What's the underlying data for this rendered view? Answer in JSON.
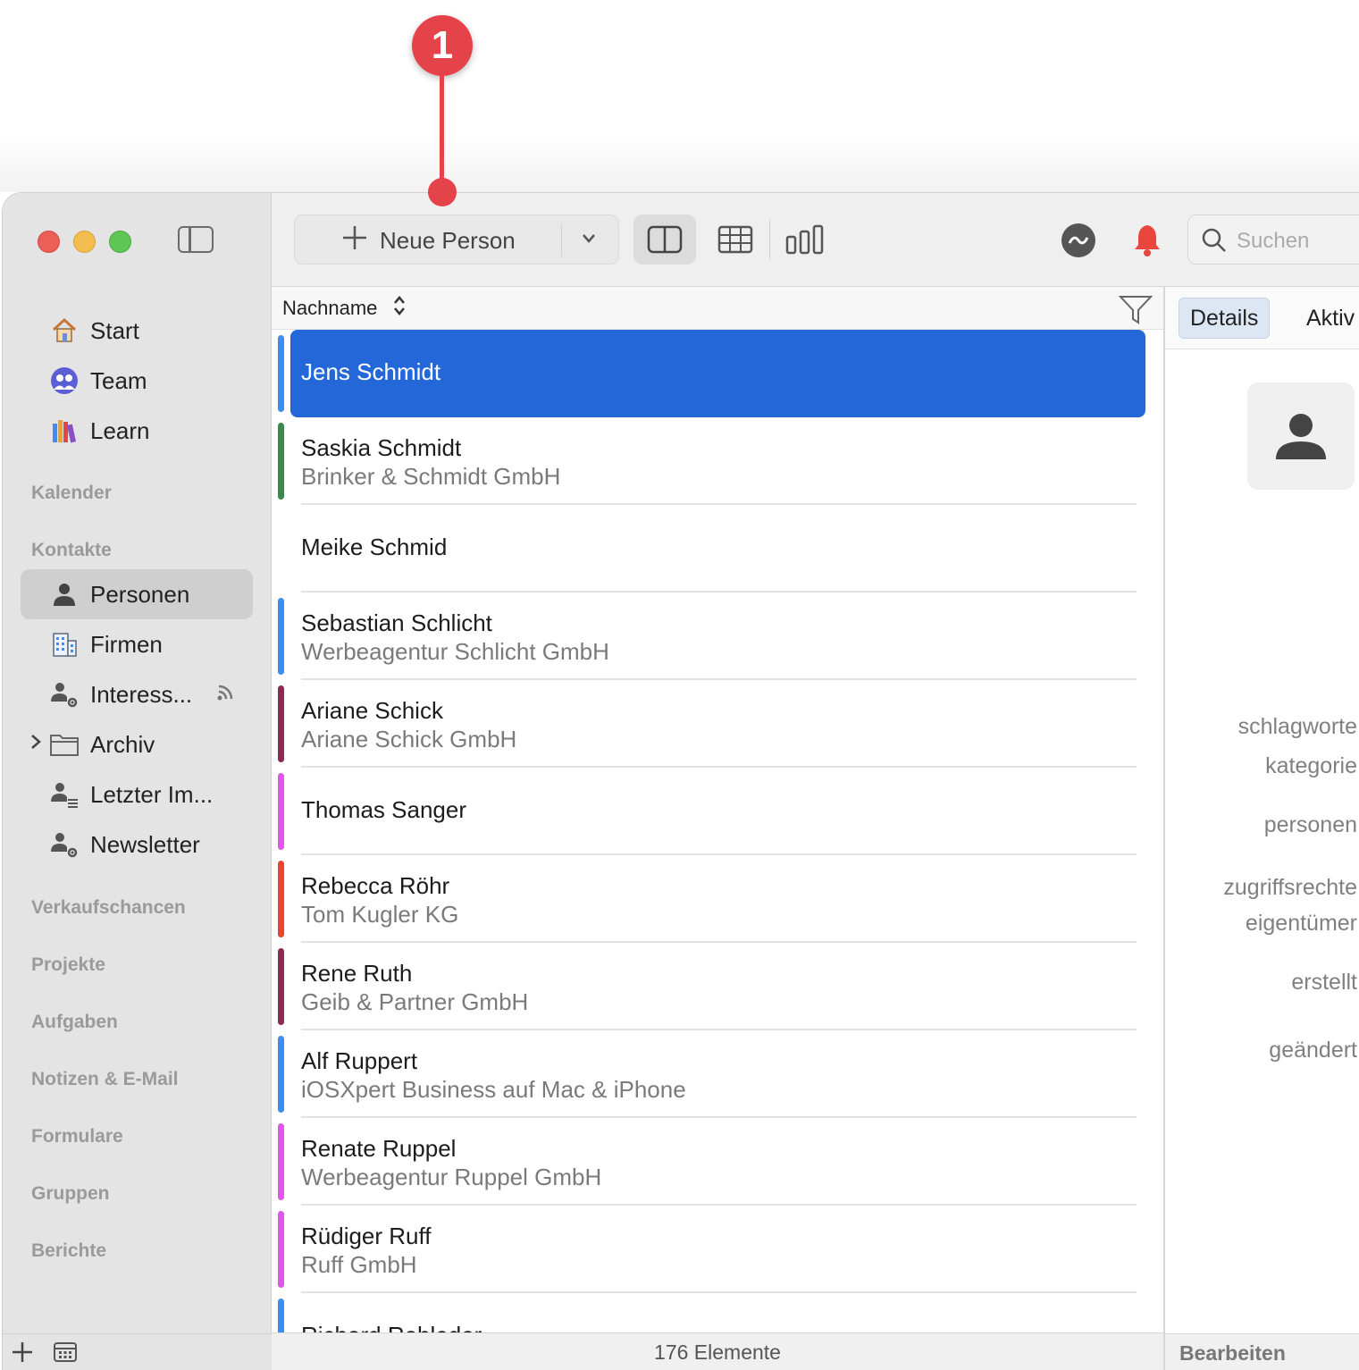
{
  "callout": {
    "number": "1"
  },
  "sidebar": {
    "items": [
      {
        "label": "Start",
        "icon": "house-icon"
      },
      {
        "label": "Team",
        "icon": "team-icon"
      },
      {
        "label": "Learn",
        "icon": "books-icon"
      }
    ],
    "sections": {
      "kalender": "Kalender",
      "kontakte": "Kontakte",
      "verkaufschancen": "Verkaufschancen",
      "projekte": "Projekte",
      "aufgaben": "Aufgaben",
      "notizen": "Notizen & E-Mail",
      "formulare": "Formulare",
      "gruppen": "Gruppen",
      "berichte": "Berichte"
    },
    "contacts": [
      {
        "label": "Personen",
        "icon": "person-icon",
        "active": true
      },
      {
        "label": "Firmen",
        "icon": "building-icon"
      },
      {
        "label": "Interess...",
        "icon": "person-gear-icon"
      },
      {
        "label": "Archiv",
        "icon": "folder-icon"
      },
      {
        "label": "Letzter Im...",
        "icon": "person-list-icon"
      },
      {
        "label": "Newsletter",
        "icon": "person-gear-icon"
      }
    ]
  },
  "toolbar": {
    "new_person_label": "Neue Person",
    "search_placeholder": "Suchen"
  },
  "list_header": {
    "sort_label": "Nachname"
  },
  "rows": [
    {
      "name": "Jens Schmidt",
      "company": "",
      "color": "#3d8ef0",
      "selected": true
    },
    {
      "name": "Saskia Schmidt",
      "company": "Brinker & Schmidt GmbH",
      "color": "#3a8a4e"
    },
    {
      "name": "Meike Schmid",
      "company": "",
      "color": ""
    },
    {
      "name": "Sebastian Schlicht",
      "company": "Werbeagentur Schlicht GmbH",
      "color": "#3d8ef0"
    },
    {
      "name": "Ariane Schick",
      "company": "Ariane Schick GmbH",
      "color": "#8a2a55"
    },
    {
      "name": "Thomas Sanger",
      "company": "",
      "color": "#e056e8"
    },
    {
      "name": "Rebecca Röhr",
      "company": "Tom Kugler KG",
      "color": "#e8472f"
    },
    {
      "name": "Rene Ruth",
      "company": "Geib & Partner GmbH",
      "color": "#8a2a55"
    },
    {
      "name": "Alf Ruppert",
      "company": "iOSXpert Business auf Mac & iPhone",
      "color": "#3d8ef0"
    },
    {
      "name": "Renate Ruppel",
      "company": "Werbeagentur Ruppel GmbH",
      "color": "#e056e8"
    },
    {
      "name": "Rüdiger Ruff",
      "company": "Ruff GmbH",
      "color": "#e056e8"
    },
    {
      "name": "Richard Rohleder",
      "company": "",
      "color": "#3d8ef0"
    }
  ],
  "status": {
    "count_label": "176 Elemente"
  },
  "detail": {
    "tabs": [
      "Details",
      "Aktiv"
    ],
    "fields": [
      "schlagworte",
      "kategorie",
      "personen",
      "zugriffsrechte",
      "eigentümer",
      "erstellt",
      "geändert"
    ],
    "edit_label": "Bearbeiten"
  }
}
